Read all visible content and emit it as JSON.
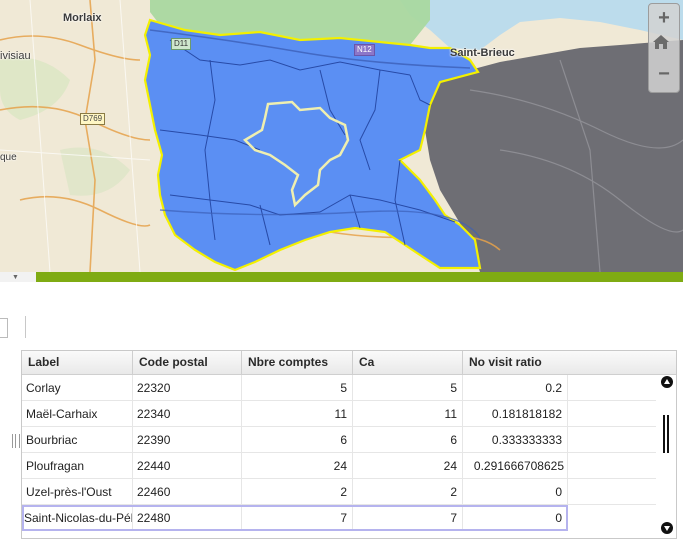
{
  "map": {
    "labels": {
      "morlaix": "Morlaix",
      "saint_brieuc": "Saint-Brieuc",
      "landivisiau": "ivisiau",
      "que": "que"
    },
    "road_badges": {
      "d11": "D11",
      "n12": "N12",
      "d769": "D769"
    },
    "colors": {
      "selected_region": "#5b8ff3",
      "neighbor_north": "#a9d8a0",
      "neighbor_east": "#6e6e74",
      "boundary_highlight": "#f3f000",
      "inner_boundary": "#efefb0",
      "divider": "#7fab13"
    },
    "zoom_controls": {
      "zoom_in_icon": "plus-icon",
      "home_icon": "home-icon",
      "zoom_out_icon": "minus-icon"
    }
  },
  "grid": {
    "columns": [
      "Label",
      "Code postal",
      "Nbre comptes",
      "Ca",
      "No visit ratio"
    ],
    "rows": [
      {
        "label": "Corlay",
        "code_postal": "22320",
        "nbre_comptes": "5",
        "ca": "5",
        "no_visit_ratio": "0.2"
      },
      {
        "label": "Maël-Carhaix",
        "code_postal": "22340",
        "nbre_comptes": "11",
        "ca": "11",
        "no_visit_ratio": "0.181818182"
      },
      {
        "label": "Bourbriac",
        "code_postal": "22390",
        "nbre_comptes": "6",
        "ca": "6",
        "no_visit_ratio": "0.333333333"
      },
      {
        "label": "Ploufragan",
        "code_postal": "22440",
        "nbre_comptes": "24",
        "ca": "24",
        "no_visit_ratio": "0.291666708625"
      },
      {
        "label": "Uzel-près-l'Oust",
        "code_postal": "22460",
        "nbre_comptes": "2",
        "ca": "2",
        "no_visit_ratio": "0"
      },
      {
        "label": "Saint-Nicolas-du-Pélem",
        "code_postal": "22480",
        "nbre_comptes": "7",
        "ca": "7",
        "no_visit_ratio": "0"
      }
    ],
    "selected_row": "Saint-Nicolas-du-Pélem"
  }
}
